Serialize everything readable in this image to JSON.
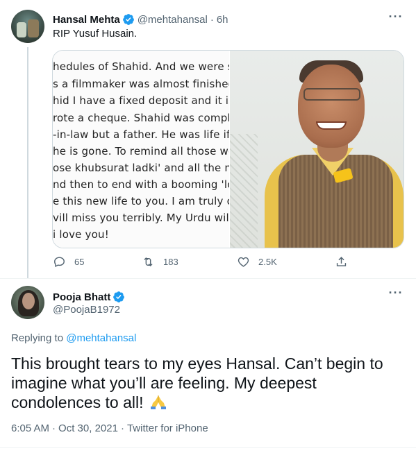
{
  "parent_tweet": {
    "author_name": "Hansal Mehta",
    "author_handle": "@mehtahansal",
    "separator": "·",
    "time_ago": "6h",
    "text": "RIP Yusuf Husain.",
    "media": {
      "text_image_lines": [
        "hedules of Shahid. And we were stu",
        "s a filmmaker was almost finished c",
        "hid I have a fixed deposit and it is of",
        "rote a cheque. Shahid was complete",
        "-in-law but a father. He was life if li",
        "he is gone. To remind all those won",
        "ose khubsurat ladki' and all the men",
        "nd then to end with a booming 'love",
        "e this new life to you. I am truly orpl",
        "vill miss you terribly. My Urdu will re",
        "i love you!"
      ],
      "photo_subject": "portrait-photo"
    },
    "actions": {
      "reply_count": "65",
      "retweet_count": "183",
      "like_count": "2.5K"
    }
  },
  "reply_tweet": {
    "author_name": "Pooja Bhatt",
    "author_handle": "@PoojaB1972",
    "replying_prefix": "Replying to",
    "replying_to": "@mehtahansal",
    "text": "This brought tears to my eyes Hansal. Can’t begin to imagine what you’ll are feeling. My deepest condolences to all!",
    "emoji": "folded-hands-icon",
    "time": "6:05 AM",
    "separator": "·",
    "date": "Oct 30, 2021",
    "source": "Twitter for iPhone"
  },
  "colors": {
    "accent": "#1d9bf0",
    "secondary_text": "#536471",
    "primary_text": "#0f1419",
    "border": "#cfd9de"
  },
  "icons": {
    "more": "more-icon",
    "verified": "verified-badge-icon",
    "reply": "reply-icon",
    "retweet": "retweet-icon",
    "like": "heart-icon",
    "share": "share-icon"
  }
}
